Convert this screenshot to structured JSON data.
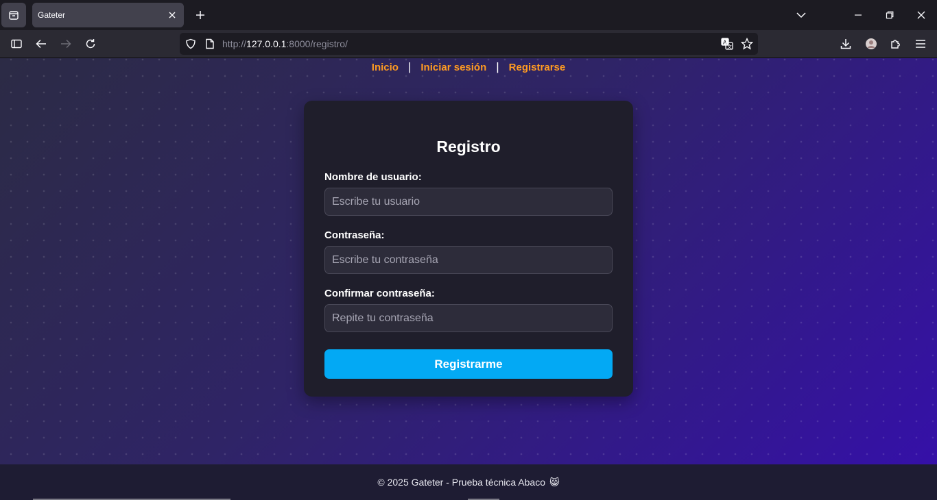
{
  "browser": {
    "tab_title": "Gateter",
    "url_prefix": "http://",
    "url_host": "127.0.0.1",
    "url_rest": ":8000/registro/"
  },
  "nav": {
    "links": [
      "Inicio",
      "Iniciar sesión",
      "Registrarse"
    ],
    "separator": "|",
    "link_color": "#ff9b21"
  },
  "form": {
    "title": "Registro",
    "fields": [
      {
        "label": "Nombre de usuario:",
        "placeholder": "Escribe tu usuario",
        "value": ""
      },
      {
        "label": "Contraseña:",
        "placeholder": "Escribe tu contraseña",
        "value": ""
      },
      {
        "label": "Confirmar contraseña:",
        "placeholder": "Repite tu contraseña",
        "value": ""
      }
    ],
    "submit_label": "Registrarme",
    "submit_color": "#03a9f4"
  },
  "footer": {
    "text": "© 2025 Gateter - Prueba técnica Abaco",
    "emoji": "😸"
  }
}
